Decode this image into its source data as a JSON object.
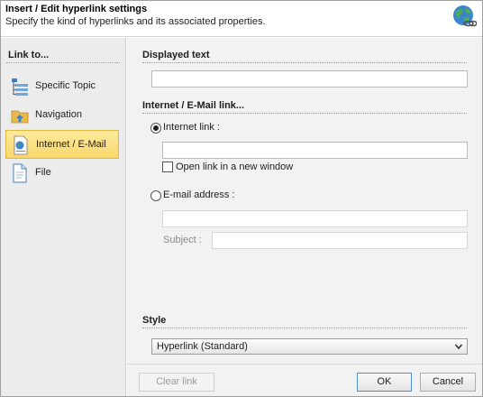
{
  "header": {
    "title": "Insert / Edit hyperlink settings",
    "subtitle": "Specify the kind of hyperlinks and its associated properties.",
    "icon": "globe-link-icon"
  },
  "sidebar": {
    "title": "Link to...",
    "items": [
      {
        "label": "Specific Topic",
        "icon": "topic-tree-icon",
        "active": false
      },
      {
        "label": "Navigation",
        "icon": "navigation-folder-icon",
        "active": false
      },
      {
        "label": "Internet / E-Mail",
        "icon": "internet-page-icon",
        "active": true
      },
      {
        "label": "File",
        "icon": "file-icon",
        "active": false
      }
    ]
  },
  "displayed_text": {
    "title": "Displayed text",
    "value": ""
  },
  "link_section": {
    "title": "Internet / E-Mail link...",
    "internet_label": "Internet link :",
    "internet_selected": true,
    "internet_value": "",
    "new_window_label": "Open link in a new window",
    "new_window_checked": false,
    "email_label": "E-mail address :",
    "email_selected": false,
    "email_value": "",
    "subject_label": "Subject :",
    "subject_value": ""
  },
  "style": {
    "title": "Style",
    "selected": "Hyperlink (Standard)"
  },
  "footer": {
    "clear_label": "Clear link",
    "ok_label": "OK",
    "cancel_label": "Cancel"
  },
  "colors": {
    "active_item": "#f9d66a",
    "panel": "#f2f2f2",
    "sidebar": "#ececec"
  }
}
